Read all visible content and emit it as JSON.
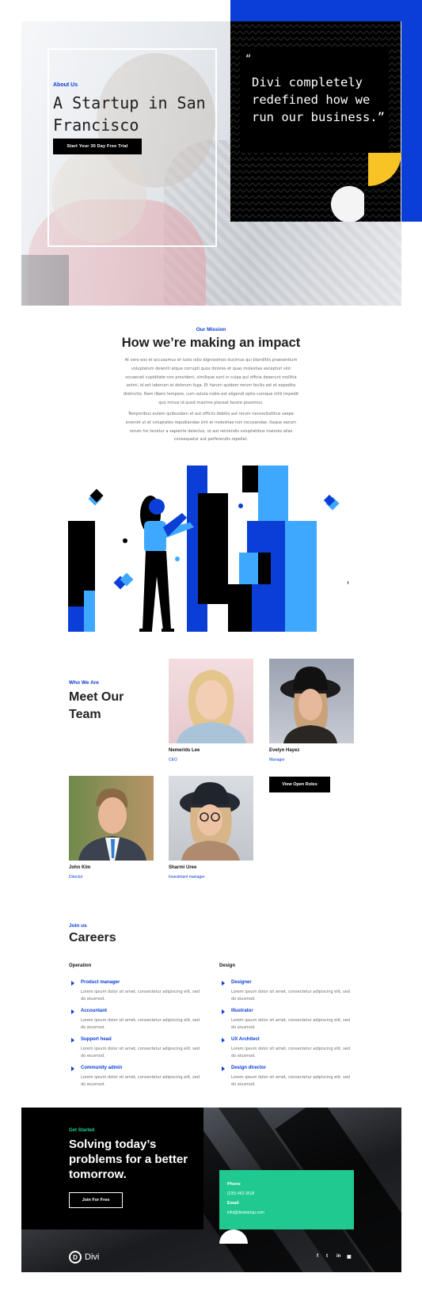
{
  "hero": {
    "kicker": "About Us",
    "title": "A Startup in San Francisco",
    "cta": "Start Your 30 Day Free Trial",
    "quote_mark": "“",
    "quote": "Divi completely redefined how we run our business.”"
  },
  "mission": {
    "kicker": "Our Mission",
    "title": "How we’re making an impact",
    "p1": "At vero eos et accusamus et iusto odio dignissimos ducimus qui blanditiis praesentium voluptatum deleniti atque corrupti quos dolores et quas molestias excepturi sint occaecati cupiditate non provident, similique sunt in culpa qui officia deserunt mollitia animi, id est laborum et dolorum fuga. Et harum quidem rerum facilis est et expedita distinctio. Nam libero tempore, cum soluta nobis est eligendi optio cumque nihil impedit quo minus id quod maxime placeat facere possimus.",
    "p2": "Temporibus autem quibusdam et aut officiis debitis aut rerum necessitatibus saepe eveniet ut et voluptates repudiandae sint et molestiae non recusandae. Itaque earum rerum hic tenetur a sapiente delectus, ut aut reiciendis voluptatibus maiores alias consequatur aut perferendis repellat."
  },
  "team": {
    "kicker": "Who We Are",
    "title": "Meet Our Team",
    "members": [
      {
        "name": "Nemerids Lee",
        "role": "CEO"
      },
      {
        "name": "Evelyn Hayez",
        "role": "Manager"
      },
      {
        "name": "John Kim",
        "role": "Director"
      },
      {
        "name": "Sharmi Uree",
        "role": "Investment manager"
      }
    ],
    "open_roles": "View Open Roles"
  },
  "careers": {
    "kicker": "Join us",
    "title": "Careers",
    "columns": [
      {
        "heading": "Operation",
        "jobs": [
          {
            "title": "Product manager",
            "desc": "Lorem ipsum dolor sit amet, consectetur adipiscing elit, sed do eiusmod."
          },
          {
            "title": "Accountant",
            "desc": "Lorem ipsum dolor sit amet, consectetur adipiscing elit, sed do eiusmod."
          },
          {
            "title": "Support head",
            "desc": "Lorem ipsum dolor sit amet, consectetur adipiscing elit, sed do eiusmod."
          },
          {
            "title": "Community admin",
            "desc": "Lorem ipsum dolor sit amet, consectetur adipiscing elit, sed do eiusmod."
          }
        ]
      },
      {
        "heading": "Design",
        "jobs": [
          {
            "title": "Designer",
            "desc": "Lorem ipsum dolor sit amet, consectetur adipiscing elit, sed do eiusmod."
          },
          {
            "title": "Illustrator",
            "desc": "Lorem ipsum dolor sit amet, consectetur adipiscing elit, sed do eiusmod."
          },
          {
            "title": "UX Architect",
            "desc": "Lorem ipsum dolor sit amet, consectetur adipiscing elit, sed do eiusmod."
          },
          {
            "title": "Design director",
            "desc": "Lorem ipsum dolor sit amet, consectetur adipiscing elit, sed do eiusmod."
          }
        ]
      }
    ]
  },
  "footer": {
    "kicker": "Get Started",
    "title": "Solving today’s problems for a better tomorrow.",
    "cta": "Join For Free",
    "phone_label": "Phone",
    "phone": "(235) 462-3518",
    "email_label": "Email",
    "email": "info@divistartup.com",
    "logo_letter": "D",
    "logo_text": "Divi",
    "social": {
      "facebook": "f",
      "twitter": "t",
      "linkedin": "in",
      "instagram": "▣"
    }
  },
  "colors": {
    "accent_blue": "#0b3ed6",
    "light_blue": "#3ea8ff",
    "green": "#1fc98f",
    "yellow": "#f7c325",
    "black": "#000000"
  }
}
